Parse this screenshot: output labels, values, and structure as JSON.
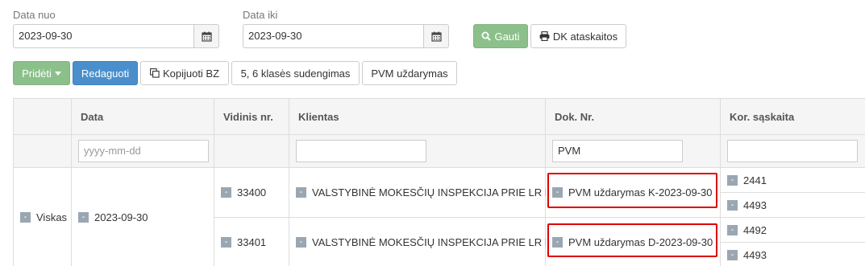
{
  "filters": {
    "date_from_label": "Data nuo",
    "date_from_value": "2023-09-30",
    "date_to_label": "Data iki",
    "date_to_value": "2023-09-30",
    "get_label": "Gauti",
    "dk_reports_label": "DK ataskaitos"
  },
  "toolbar": {
    "add_label": "Pridėti",
    "edit_label": "Redaguoti",
    "copy_label": "Kopijuoti BZ",
    "merge_label": "5, 6 klasės sudengimas",
    "vat_close_label": "PVM uždarymas"
  },
  "table": {
    "columns": [
      "",
      "Data",
      "Vidinis nr.",
      "Klientas",
      "Dok. Nr.",
      "Kor. sąskaita"
    ],
    "filters": {
      "date_placeholder": "yyyy-mm-dd",
      "doc_value": "PVM"
    },
    "group_label": "Viskas",
    "group_date": "2023-09-30",
    "rows": [
      {
        "internal_nr": "33400",
        "client": "VALSTYBINĖ MOKESČIŲ INSPEKCIJA PRIE LR FM",
        "doc_nr": "PVM uždarymas K-2023-09-30",
        "accounts": [
          "2441",
          "4493"
        ]
      },
      {
        "internal_nr": "33401",
        "client": "VALSTYBINĖ MOKESČIŲ INSPEKCIJA PRIE LR FM",
        "doc_nr": "PVM uždarymas D-2023-09-30",
        "accounts": [
          "4492",
          "4493"
        ]
      }
    ]
  },
  "colors": {
    "green": "#8cc08b",
    "blue": "#4a8fcb",
    "highlight": "#e00000"
  }
}
